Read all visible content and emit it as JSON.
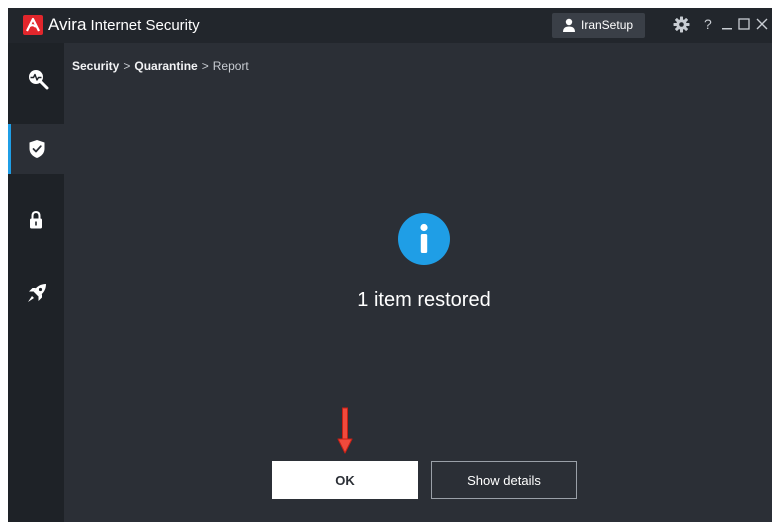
{
  "app": {
    "name_main": "Avira",
    "name_sub": "Internet Security",
    "logo_icon": "avira-umbrella-logo",
    "brand_color": "#e2262c"
  },
  "titlebar": {
    "user_label": "IranSetup",
    "user_icon": "user-icon",
    "settings_icon": "gear-icon",
    "help_label": "?",
    "minimize_icon": "minimize-icon",
    "maximize_icon": "maximize-icon",
    "close_icon": "close-icon"
  },
  "sidebar": {
    "items": [
      {
        "name": "scan",
        "icon": "scan-search-icon",
        "active": false
      },
      {
        "name": "security",
        "icon": "shield-check-icon",
        "active": true
      },
      {
        "name": "privacy",
        "icon": "lock-icon",
        "active": false
      },
      {
        "name": "performance",
        "icon": "rocket-icon",
        "active": false
      }
    ],
    "accent_color": "#1f9ee6"
  },
  "breadcrumb": {
    "items": [
      "Security",
      "Quarantine"
    ],
    "separator": ">",
    "current": "Report"
  },
  "main": {
    "status_icon": "info-icon",
    "status_icon_color": "#1f9ee6",
    "message": "1 item restored",
    "annotation_icon": "red-down-arrow-icon"
  },
  "buttons": {
    "ok_label": "OK",
    "details_label": "Show details"
  }
}
